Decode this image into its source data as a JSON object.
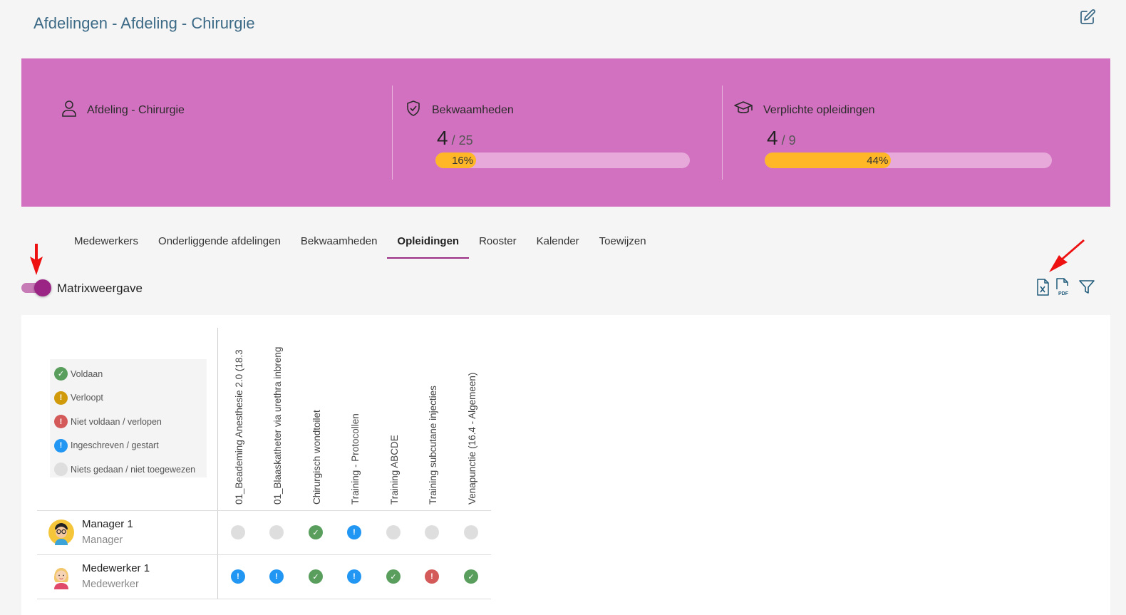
{
  "header": {
    "title": "Afdelingen - Afdeling - Chirurgie",
    "edit_icon": "edit-icon"
  },
  "banner": {
    "color": "#d271c0",
    "department": {
      "icon": "user-icon",
      "label": "Afdeling - Chirurgie"
    },
    "competencies": {
      "icon": "shield-check-icon",
      "label": "Bekwaamheden",
      "count": "4",
      "total": "/ 25",
      "percent_label": "16%",
      "progress": 0.16
    },
    "trainings": {
      "icon": "graduation-cap-icon",
      "label": "Verplichte opleidingen",
      "count": "4",
      "total": "/ 9",
      "percent_label": "44%",
      "progress": 0.44
    }
  },
  "tabs": [
    {
      "label": "Medewerkers",
      "active": false
    },
    {
      "label": "Onderliggende afdelingen",
      "active": false
    },
    {
      "label": "Bekwaamheden",
      "active": false
    },
    {
      "label": "Opleidingen",
      "active": true
    },
    {
      "label": "Rooster",
      "active": false
    },
    {
      "label": "Kalender",
      "active": false
    },
    {
      "label": "Toewijzen",
      "active": false
    }
  ],
  "matrix_toggle": {
    "label": "Matrixweergave",
    "on": true
  },
  "toolbar": {
    "excel_icon": "excel-export-icon",
    "pdf_icon": "pdf-export-icon",
    "filter_icon": "filter-icon"
  },
  "legend": [
    {
      "status": "green",
      "label": "Voldaan"
    },
    {
      "status": "amber",
      "label": "Verloopt"
    },
    {
      "status": "red",
      "label": "Niet voldaan / verlopen"
    },
    {
      "status": "blue",
      "label": "Ingeschreven / gestart"
    },
    {
      "status": "grey",
      "label": "Niets gedaan / niet toegewezen"
    }
  ],
  "columns": [
    "01_Beademing Anesthesie 2.0 (18.3",
    "01_Blaaskatheter via urethra inbreng",
    "Chirurgisch wondtoilet",
    "Training - Protocollen",
    "Training ABCDE",
    "Training subcutane injecties",
    "Venapunctie (16.4 - Algemeen)"
  ],
  "rows": [
    {
      "name": "Manager 1",
      "role": "Manager",
      "avatar": "manager-avatar-icon",
      "statuses": [
        "grey",
        "grey",
        "green",
        "blue",
        "grey",
        "grey",
        "grey"
      ]
    },
    {
      "name": "Medewerker 1",
      "role": "Medewerker",
      "avatar": "employee-avatar-icon",
      "statuses": [
        "blue",
        "blue",
        "green",
        "blue",
        "green",
        "red",
        "green"
      ]
    }
  ],
  "colors": {
    "accent": "#9b2585",
    "progress": "#ffb627",
    "title": "#3c6a86",
    "arrow": "#ee1111"
  }
}
